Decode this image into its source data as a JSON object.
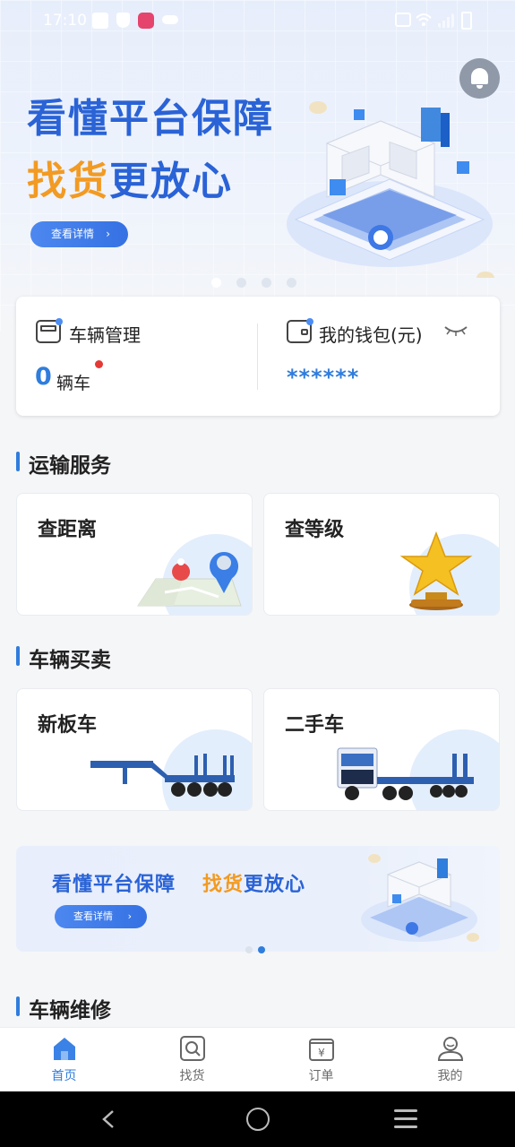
{
  "status_bar": {
    "time": "17:10",
    "icons": [
      "mail-icon",
      "shield-icon",
      "app-icon",
      "cloud-icon",
      "vibrate-icon",
      "wifi-icon",
      "signal-icon",
      "battery-icon"
    ]
  },
  "hero_banner": {
    "title_line1": "看懂平台保障",
    "title_line2_orange": "找货",
    "title_line2_blue": "更放心",
    "button_label": "查看详情",
    "button_chevron": "›",
    "page_count": 4,
    "active_page": 1
  },
  "summary": {
    "vehicles": {
      "label": "车辆管理",
      "count": "0",
      "unit": "辆车"
    },
    "wallet": {
      "label": "我的钱包(元)",
      "value": "******"
    }
  },
  "sections": {
    "transport": {
      "title": "运输服务",
      "items": [
        {
          "label": "查距离",
          "icon": "map-pin-icon"
        },
        {
          "label": "查等级",
          "icon": "star-trophy-icon"
        }
      ]
    },
    "vehicle_trade": {
      "title": "车辆买卖",
      "items": [
        {
          "label": "新板车",
          "icon": "trailer-image"
        },
        {
          "label": "二手车",
          "icon": "truck-image"
        }
      ]
    },
    "repair": {
      "title": "车辆维修"
    }
  },
  "promo_banner": {
    "text1": "看懂平台保障",
    "text2_orange": "找货",
    "text2_blue": "更放心",
    "button_label": "查看详情",
    "button_chevron": "›",
    "page_count": 2,
    "active_page": 2
  },
  "tab_bar": {
    "tabs": [
      {
        "label": "首页",
        "icon": "home-icon",
        "active": true
      },
      {
        "label": "找货",
        "icon": "search-icon",
        "active": false
      },
      {
        "label": "订单",
        "icon": "order-icon",
        "active": false
      },
      {
        "label": "我的",
        "icon": "profile-icon",
        "active": false
      }
    ]
  },
  "colors": {
    "accent": "#2f7ddc",
    "title_blue": "#2a63d6",
    "title_orange": "#f29a22",
    "badge_red": "#e53935"
  }
}
